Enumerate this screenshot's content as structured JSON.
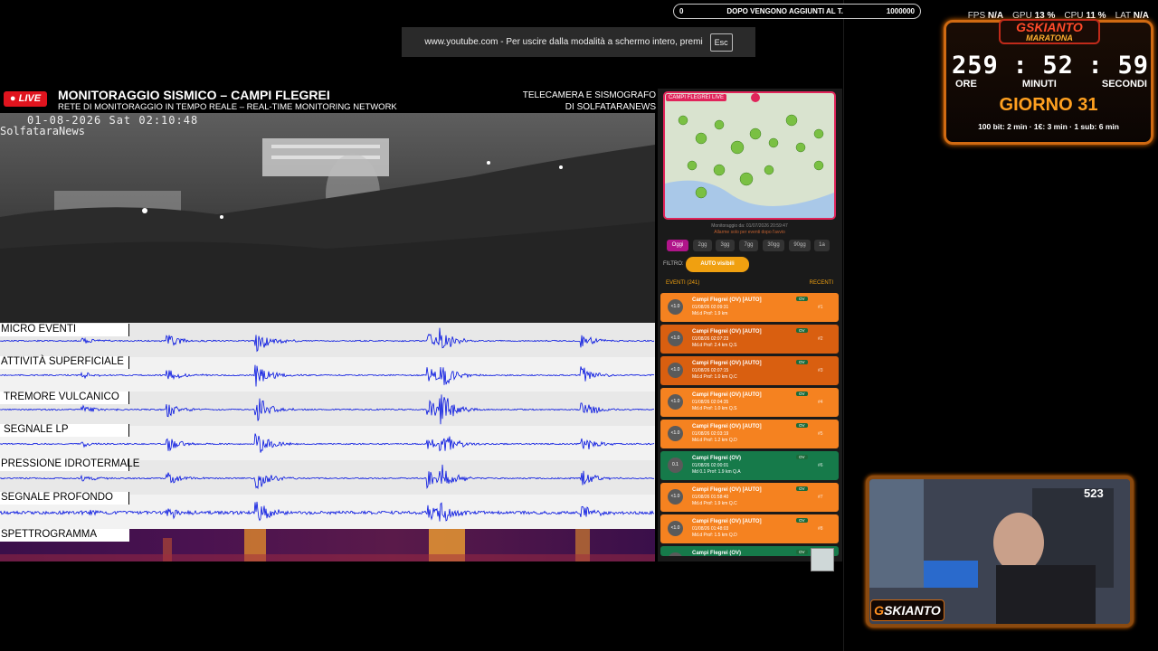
{
  "overlay": {
    "progress_left": "0",
    "progress_text": "DOPO VENGONO AGGIUNTI AL T.",
    "progress_right": "1000000",
    "stats": {
      "fps_label": "FPS",
      "fps_value": "N/A",
      "gpu_label": "GPU",
      "gpu_value": "13 %",
      "cpu_label": "CPU",
      "cpu_value": "11 %",
      "lat_label": "LAT",
      "lat_value": "N/A"
    }
  },
  "toast": {
    "text": "www.youtube.com - Per uscire dalla modalità a schermo intero, premi",
    "key": "Esc"
  },
  "timer": {
    "brand": "GSKIANTO",
    "brand_sub": "MARATONA",
    "hours": "259",
    "minutes": "52",
    "seconds": "59",
    "hours_label": "ORE",
    "minutes_label": "MINUTI",
    "seconds_label": "SECONDI",
    "sep": ":",
    "day": "GIORNO 31",
    "rates": "100 bit: 2 min · 1€: 3 min · 1 sub: 6 min"
  },
  "stream": {
    "live": "LIVE",
    "title": "MONITORAGGIO SISMICO – CAMPI FLEGREI",
    "subtitle": "RETE DI MONITORAGGIO IN TEMPO REALE – REAL-TIME MONITORING NETWORK",
    "right_title_1": "TELECAMERA E SISMOGRAFO",
    "right_title_2": "DI SOLFATARANEWS",
    "cam_timestamp": "01-08-2026 Sat 02:10:48",
    "cam_name": "SolfataraNews",
    "channels": [
      "MICRO EVENTI",
      "ATTIVITÀ SUPERFICIALE",
      "TREMORE VULCANICO",
      "SEGNALE LP",
      "PRESSIONE IDROTERMALE",
      "SEGNALE PROFONDO"
    ],
    "spectro_label": "SPETTROGRAMMA"
  },
  "side": {
    "map_tag": "CAMPI FLEGREI LIVE",
    "map_note_1": "Monitoraggio da: 01/07/2026 20:59:47",
    "map_note_2": "Allarme solo per eventi dopo l'avvio",
    "chips": [
      "Oggi",
      "2gg",
      "3gg",
      "7gg",
      "30gg",
      "90gg",
      "1a"
    ],
    "filter_label": "FILTRO:",
    "filter_btn": "AUTO visibili",
    "events_title": "EVENTI (241)",
    "events_link": "RECENTI",
    "events": [
      {
        "mag": "<1.0",
        "title": "Campi Flegrei (OV) [AUTO]",
        "date": "01/08/26 02:09:31",
        "meta": "Md.d Prof: 1.9 km",
        "num": "#1",
        "style": ""
      },
      {
        "mag": "<1.0",
        "title": "Campi Flegrei (OV) [AUTO]",
        "date": "01/08/26 02:07:23",
        "meta": "Md.d Prof: 2.4 km Q.S",
        "num": "#2",
        "style": "dk"
      },
      {
        "mag": "<1.0",
        "title": "Campi Flegrei (OV) [AUTO]",
        "date": "01/08/26 02:07:15",
        "meta": "Md.d Prof: 1.0 km Q.C",
        "num": "#3",
        "style": "dk"
      },
      {
        "mag": "<1.0",
        "title": "Campi Flegrei (OV) [AUTO]",
        "date": "01/08/26 02:04:35",
        "meta": "Md.d Prof: 1.0 km Q.S",
        "num": "#4",
        "style": ""
      },
      {
        "mag": "<1.0",
        "title": "Campi Flegrei (OV) [AUTO]",
        "date": "01/08/26 02:03:19",
        "meta": "Md.d Prof: 1.2 km Q.D",
        "num": "#5",
        "style": ""
      },
      {
        "mag": "0.1",
        "title": "Campi Flegrei (OV)",
        "date": "01/08/26 02:00:01",
        "meta": "Md 0.1 Prof: 1.9 km Q.A",
        "num": "#6",
        "style": "gr"
      },
      {
        "mag": "<1.0",
        "title": "Campi Flegrei (OV) [AUTO]",
        "date": "01/08/26 01:58:40",
        "meta": "Md.d Prof: 1.9 km Q.C",
        "num": "#7",
        "style": ""
      },
      {
        "mag": "<1.0",
        "title": "Campi Flegrei (OV) [AUTO]",
        "date": "01/08/26 01:48:03",
        "meta": "Md.d Prof: 1.5 km Q.D",
        "num": "#8",
        "style": ""
      },
      {
        "mag": "",
        "title": "Campi Flegrei (OV)",
        "date": "",
        "meta": "",
        "num": "",
        "style": "gr"
      }
    ],
    "ov_tag": "OV"
  },
  "webcam": {
    "viewers": "523",
    "logo_g": "G",
    "logo_rest": "SKIANTO"
  },
  "colors": {
    "accent": "#f58220",
    "live_red": "#e0141e",
    "trace_blue": "#0010e0",
    "timer_orange": "#ffa020"
  }
}
